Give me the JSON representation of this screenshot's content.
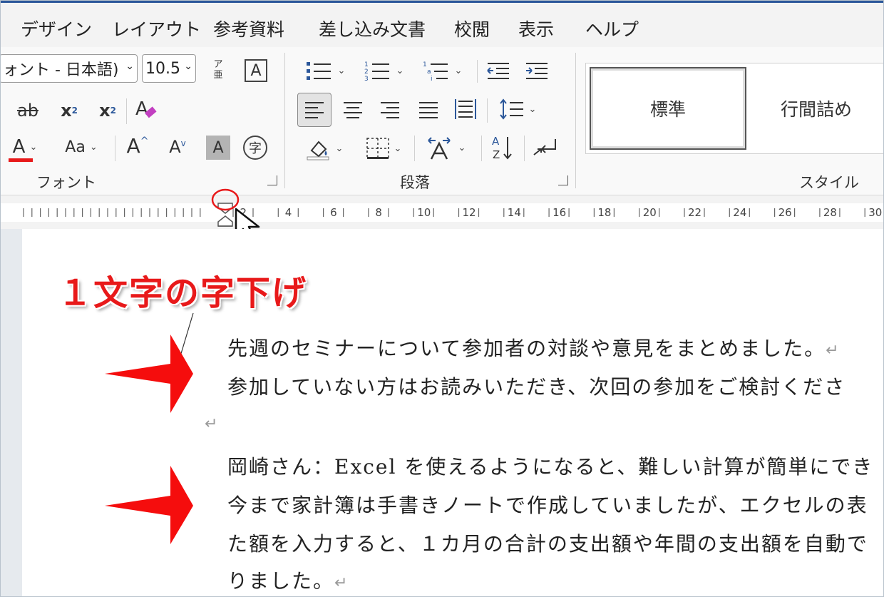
{
  "tabs": [
    "デザイン",
    "レイアウト",
    "参考資料",
    "差し込み文書",
    "校閲",
    "表示",
    "ヘルプ"
  ],
  "font": {
    "name_value": "ォント - 日本語)",
    "size_value": "10.5",
    "group_label": "フォント",
    "furigana_top": "ア",
    "furigana_bottom": "亜",
    "boxed_a": "A",
    "strike": "ab",
    "subscript": "x",
    "subscript_mark": "2",
    "superscript": "x",
    "superscript_mark": "2",
    "font_color": "A",
    "change_case": "Aa",
    "grow": "A",
    "shrink": "A",
    "shading": "A",
    "enclosed": "字"
  },
  "paragraph": {
    "group_label": "段落"
  },
  "styles": {
    "group_label": "スタイル",
    "items": [
      "標準",
      "行間詰め"
    ]
  },
  "ruler": {
    "labels": [
      "2",
      "4",
      "6",
      "8",
      "10",
      "12",
      "14",
      "16",
      "18",
      "20",
      "22",
      "24",
      "26",
      "28",
      "30"
    ]
  },
  "document": {
    "lines": [
      "先週のセミナーについて参加者の対談や意見をまとめました。",
      "参加していない方はお読みいただき、次回の参加をご検討くださ",
      "",
      "岡崎さん：Excel を使えるようになると、難しい計算が簡単にでき",
      "今まで家計簿は手書きノートで作成していましたが、エクセルの表",
      "た額を入力すると、１カ月の合計の支出額や年間の支出額を自動で",
      "りました。"
    ],
    "paragraph_mark": "↵"
  },
  "annotation": {
    "text": "１文字の字下げ"
  },
  "colors": {
    "accent": "#2b579a",
    "annotation_red": "#e8191a",
    "font_color_bar": "#e8191a"
  }
}
